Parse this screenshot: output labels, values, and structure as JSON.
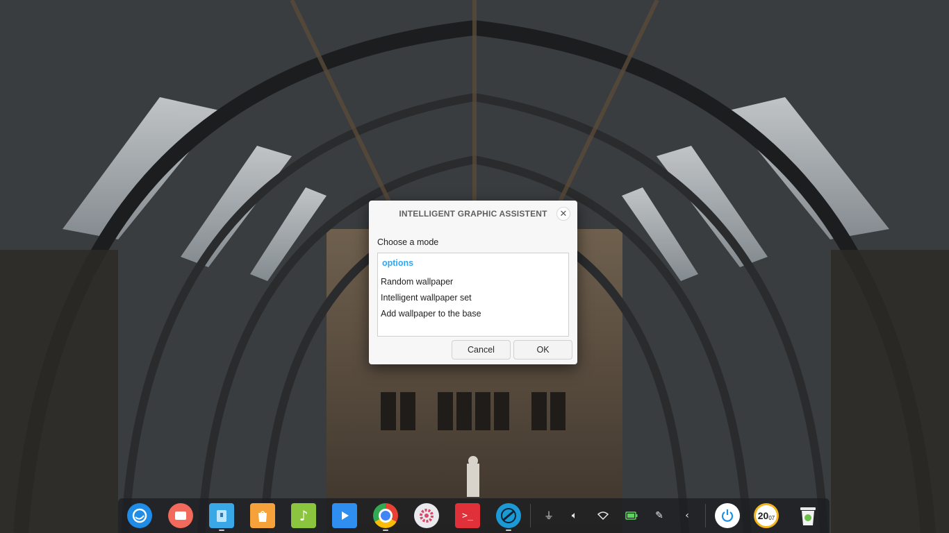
{
  "dialog": {
    "title": "INTELLIGENT GRAPHIC ASSISTENT",
    "close_icon": "close-icon",
    "prompt": "Choose a mode",
    "list_header": "options",
    "options": [
      "Random wallpaper",
      "Intelligent wallpaper set",
      "Add wallpaper to the base"
    ],
    "cancel_label": "Cancel",
    "ok_label": "OK",
    "accent_color": "#2ca7f8"
  },
  "dock": {
    "apps": [
      {
        "name": "launcher-icon",
        "color": "#1f8de8"
      },
      {
        "name": "screen-recorder-icon",
        "color": "#f26a5b"
      },
      {
        "name": "file-manager-icon",
        "color": "#3aa8e6"
      },
      {
        "name": "app-store-icon",
        "color": "#f6a23a"
      },
      {
        "name": "music-icon",
        "color": "#8bc53f"
      },
      {
        "name": "video-player-icon",
        "color": "#2e8ff0"
      },
      {
        "name": "chrome-icon",
        "color": "#e94235"
      },
      {
        "name": "settings-icon",
        "color": "#e9e9ee"
      },
      {
        "name": "terminal-icon",
        "color": "#e0313a"
      },
      {
        "name": "browser-icon",
        "color": "#1b9ad6"
      }
    ],
    "tray": [
      "usb-icon",
      "volume-icon",
      "wifi-icon",
      "battery-icon",
      "pen-icon",
      "chevron-left-icon"
    ],
    "clock": {
      "hour": "20",
      "minute": "07"
    },
    "power_icon": "power-icon",
    "trash_icon": "trash-icon"
  }
}
